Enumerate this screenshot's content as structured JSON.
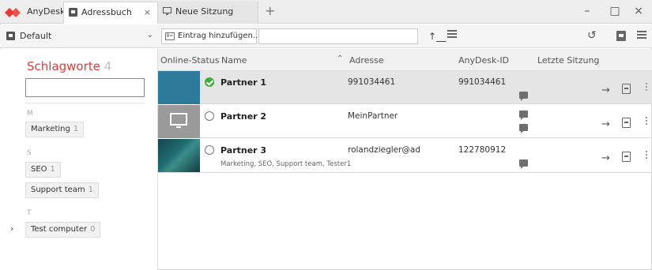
{
  "app": {
    "name": "AnyDesk",
    "colors": {
      "brand": "#e53935",
      "online": "#3fae3f"
    }
  },
  "tabs": [
    {
      "label": "Adressbuch",
      "close": "×",
      "icon": "address-book-icon"
    },
    {
      "label": "Neue Sitzung",
      "icon": "monitor-icon"
    }
  ],
  "tab_add": "+",
  "window": {
    "minimize": "–",
    "maximize": "□",
    "close": "×"
  },
  "toolbar": {
    "address_book_select": "Default",
    "add_entry_label": "Eintrag hinzufügen...",
    "search_value": ""
  },
  "sidebar": {
    "title": "Schlagworte",
    "count": "4",
    "search_value": "",
    "groups": [
      {
        "letter": "M",
        "tags": [
          {
            "name": "Marketing",
            "count": "1"
          }
        ]
      },
      {
        "letter": "S",
        "tags": [
          {
            "name": "SEO",
            "count": "1"
          },
          {
            "name": "Support team",
            "count": "1"
          }
        ]
      },
      {
        "letter": "T",
        "tags": [
          {
            "name": "Test computer",
            "count": "0"
          }
        ]
      }
    ]
  },
  "columns": {
    "status": "Online-Status",
    "name": "Name",
    "address": "Adresse",
    "id": "AnyDesk-ID",
    "last_session": "Letzte Sitzung"
  },
  "rows": [
    {
      "name": "Partner 1",
      "address": "991034461",
      "id": "991034461",
      "tags": "",
      "online": true,
      "selected": true
    },
    {
      "name": "Partner 2",
      "address": "MeinPartner",
      "id": "",
      "tags": "",
      "online": false,
      "selected": false
    },
    {
      "name": "Partner 3",
      "address": "rolandziegler@ad",
      "id": "122780912",
      "tags": "Marketing, SEO, Support team, Tester1",
      "online": false,
      "selected": false
    }
  ]
}
